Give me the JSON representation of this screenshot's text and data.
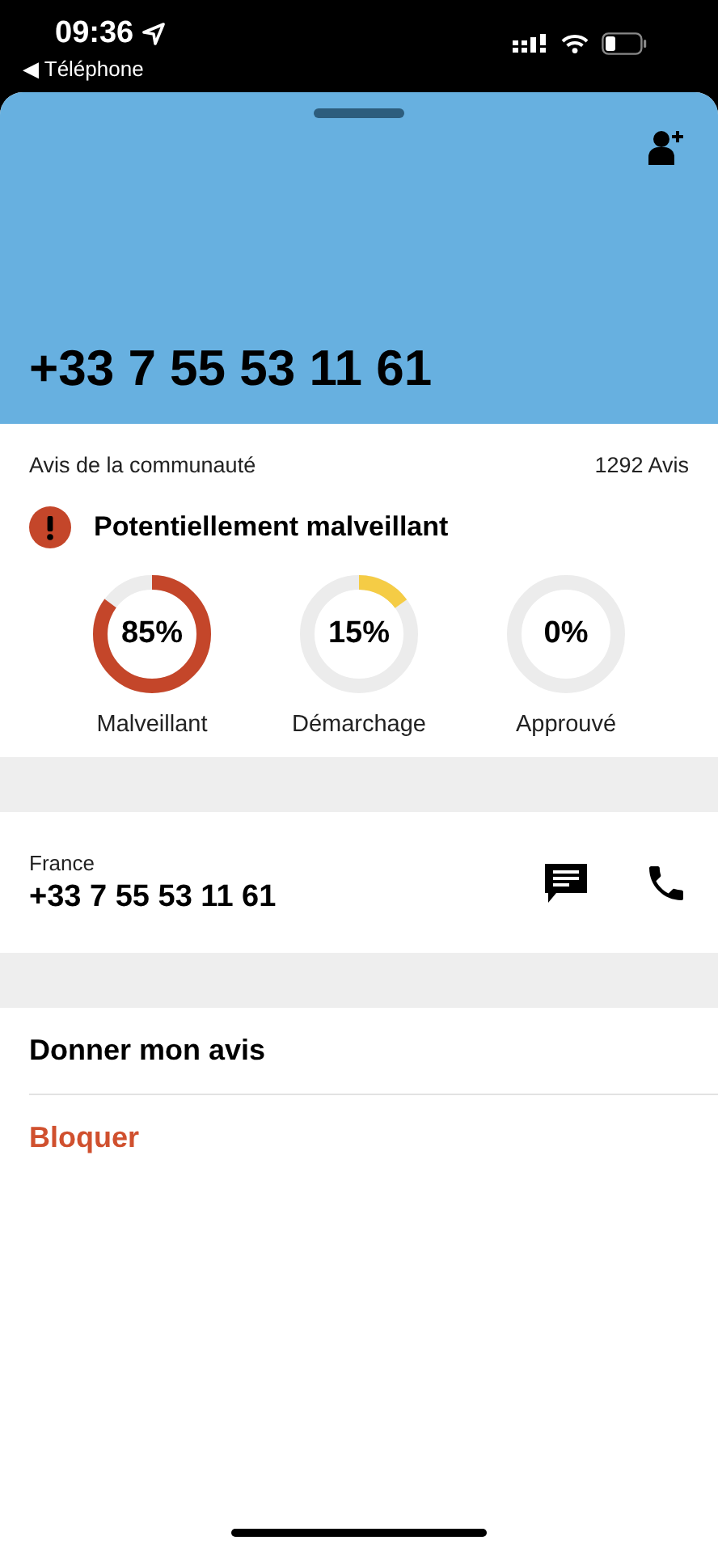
{
  "status_bar": {
    "time": "09:36",
    "back_app": "◀ Téléphone"
  },
  "header": {
    "number": "+33 7 55 53 11 61"
  },
  "community": {
    "title": "Avis de la communauté",
    "count": "1292 Avis",
    "verdict": "Potentiellement malveillant",
    "gauges": [
      {
        "label": "Malveillant",
        "value": "85%",
        "color": "#c4462a"
      },
      {
        "label": "Démarchage",
        "value": "15%",
        "color": "#f5cc45"
      },
      {
        "label": "Approuvé",
        "value": "0%"
      }
    ]
  },
  "contact": {
    "country": "France",
    "number": "+33 7 55 53 11 61"
  },
  "actions": [
    {
      "label": "Donner mon avis",
      "kind": "normal"
    },
    {
      "label": "Bloquer",
      "kind": "destructive"
    }
  ]
}
